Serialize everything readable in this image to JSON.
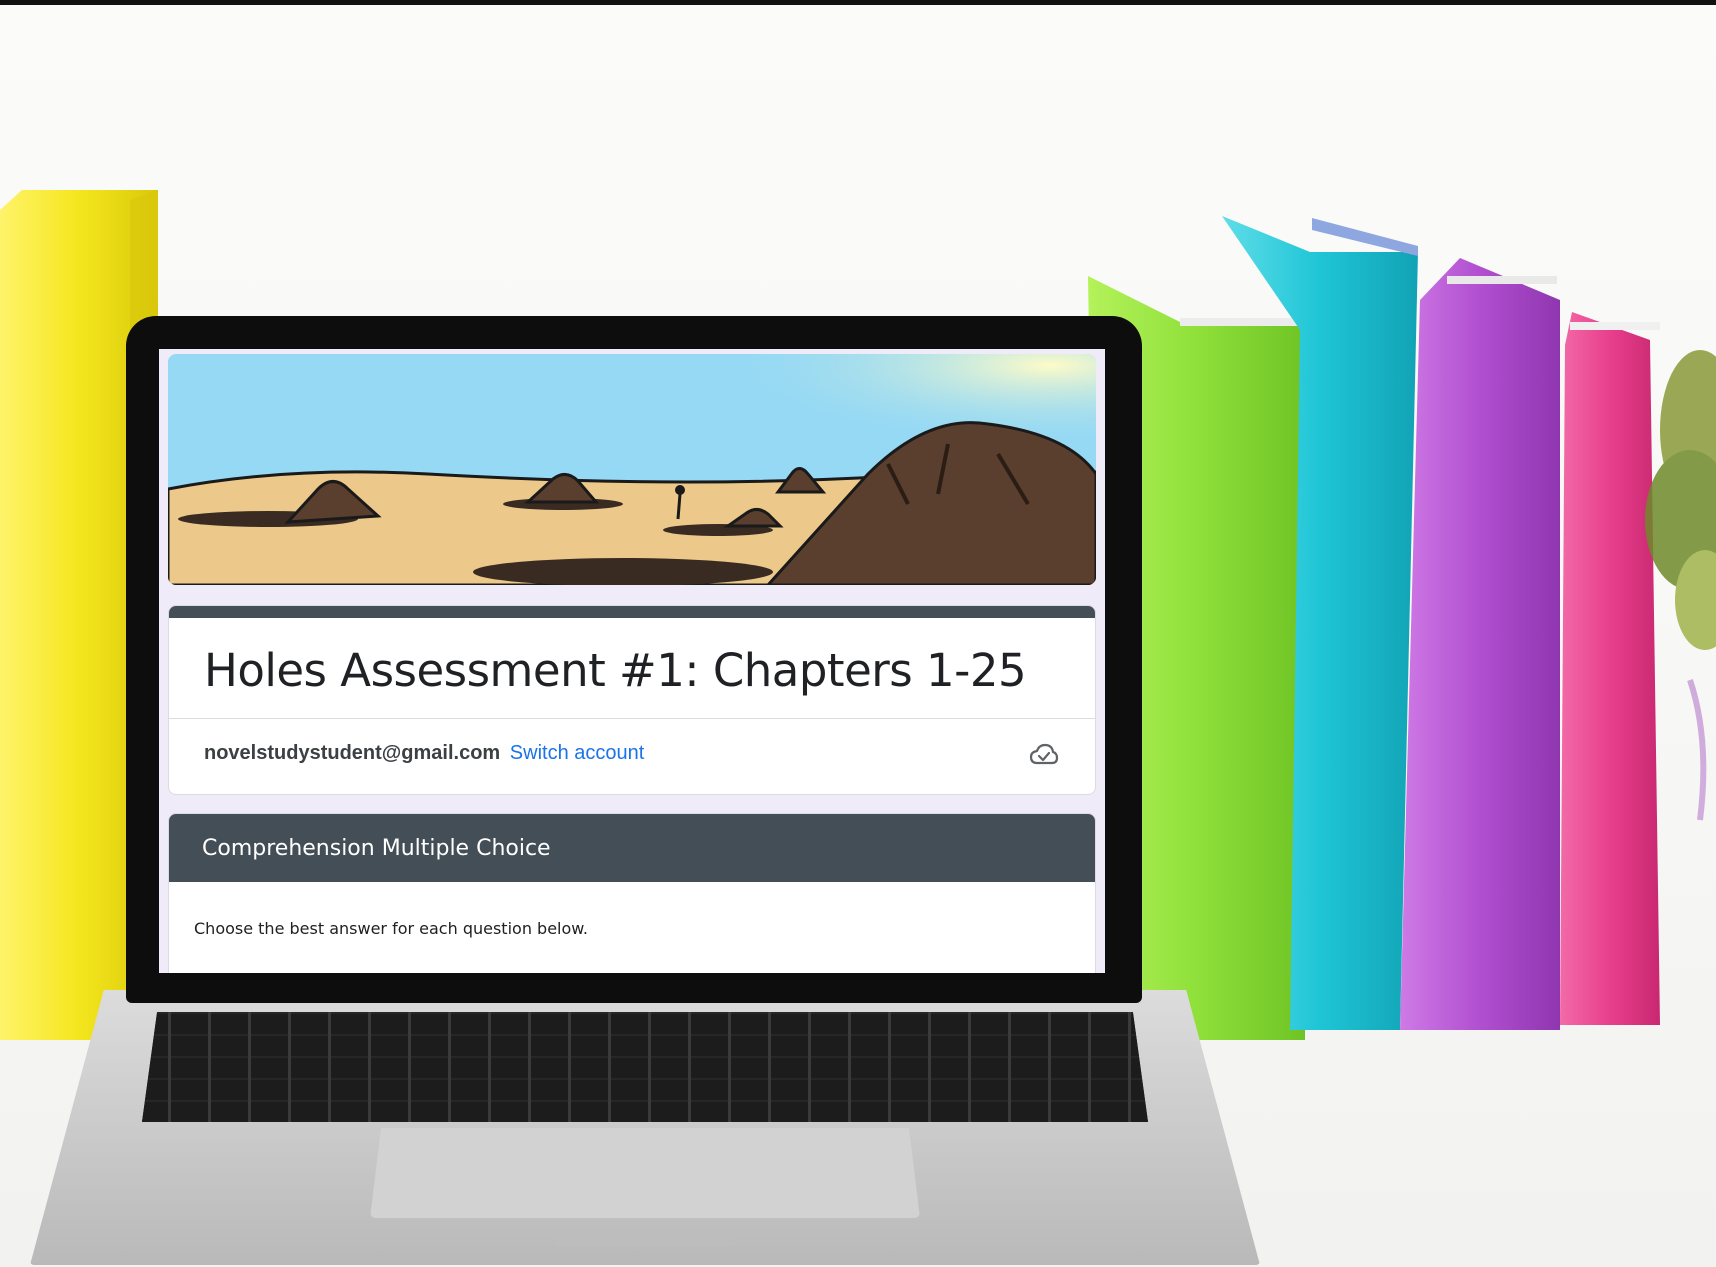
{
  "form": {
    "title": "Holes Assessment #1: Chapters 1-25",
    "account_email": "novelstudystudent@gmail.com",
    "switch_account_label": "Switch account",
    "save_status_icon": "cloud-check-icon",
    "section": {
      "title": "Comprehension Multiple Choice",
      "description": "Choose the best answer for each question below."
    }
  },
  "colors": {
    "accent": "#434e56",
    "link": "#1a73e8",
    "book_yellow": "#f4e61d",
    "book_green": "#8fe03a",
    "book_teal": "#1ec5d6",
    "book_purple": "#b14fd0",
    "book_pink": "#e83f8c"
  }
}
